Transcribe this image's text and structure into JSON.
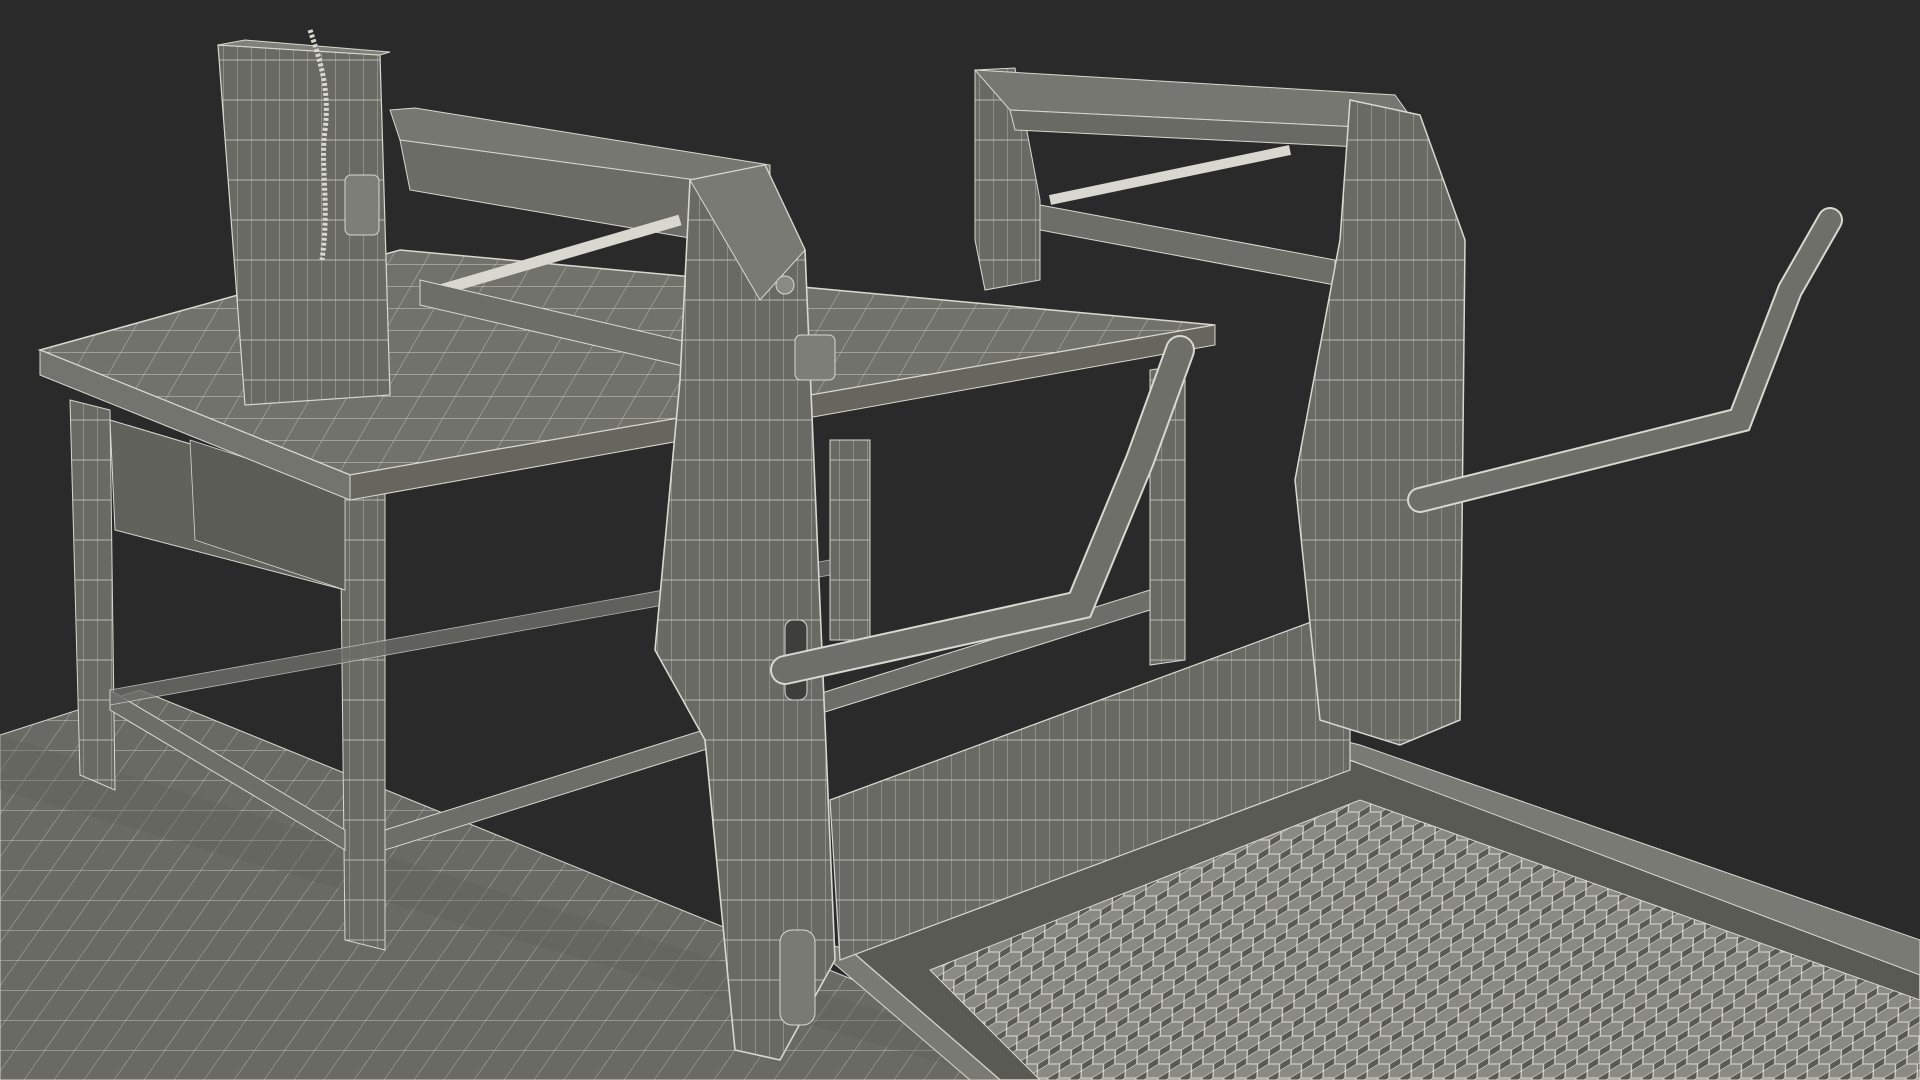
{
  "scene": {
    "subject": "wireframe-render",
    "colors": {
      "background": "#2a2a2a",
      "surface": "#6b6b66",
      "surface_light": "#7d7d78",
      "surface_dark": "#55554f",
      "wire": "#d8d8d0",
      "shadow": "#3a3a37"
    }
  }
}
